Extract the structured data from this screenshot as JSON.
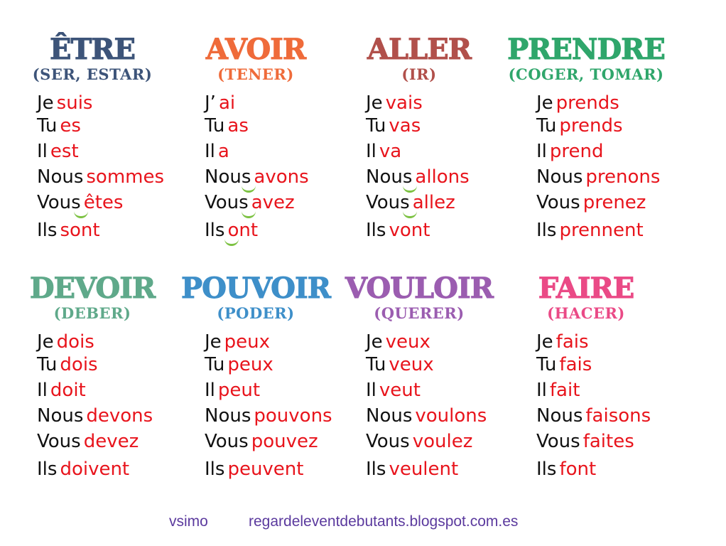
{
  "colors": {
    "pronoun": "#111111",
    "form": "#e8141c",
    "liaison": "#7cc242",
    "footer": "#5b3a9e"
  },
  "verbs": [
    {
      "title": "ÊTRE",
      "translation": "(SER, ESTAR)",
      "color": "#3d5479",
      "rows": [
        [
          "Je",
          "suis"
        ],
        [
          "Tu",
          "es"
        ],
        [
          "Il",
          "est"
        ],
        [
          "Nous",
          "sommes"
        ],
        [
          "Vous",
          "êtes"
        ],
        [
          "Ils",
          "sont"
        ]
      ]
    },
    {
      "title": "AVOIR",
      "translation": "(TENER)",
      "color": "#ef6b3a",
      "rows": [
        [
          "J’",
          "ai"
        ],
        [
          "Tu",
          "as"
        ],
        [
          "Il",
          "a"
        ],
        [
          "Nous",
          "avons"
        ],
        [
          "Vous",
          "avez"
        ],
        [
          "Ils",
          "ont"
        ]
      ]
    },
    {
      "title": "ALLER",
      "translation": "(IR)",
      "color": "#b1504b",
      "rows": [
        [
          "Je",
          "vais"
        ],
        [
          "Tu",
          "vas"
        ],
        [
          "Il",
          "va"
        ],
        [
          "Nous",
          "allons"
        ],
        [
          "Vous",
          "allez"
        ],
        [
          "Ils",
          "vont"
        ]
      ]
    },
    {
      "title": "PRENDRE",
      "translation": "(COGER, TOMAR)",
      "color": "#2fa66b",
      "rows": [
        [
          "Je",
          "prends"
        ],
        [
          "Tu",
          "prends"
        ],
        [
          "Il",
          "prend"
        ],
        [
          "Nous",
          "prenons"
        ],
        [
          "Vous",
          "prenez"
        ],
        [
          "Ils",
          "prennent"
        ]
      ]
    },
    {
      "title": "DEVOIR",
      "translation": "(DEBER)",
      "color": "#5fa98a",
      "rows": [
        [
          "Je",
          "dois"
        ],
        [
          "Tu",
          "dois"
        ],
        [
          "Il",
          "doit"
        ],
        [
          "Nous",
          "devons"
        ],
        [
          "Vous",
          "devez"
        ],
        [
          "Ils",
          "doivent"
        ]
      ]
    },
    {
      "title": "POUVOIR",
      "translation": "(PODER)",
      "color": "#3e8fc9",
      "rows": [
        [
          "Je",
          "peux"
        ],
        [
          "Tu",
          "peux"
        ],
        [
          "Il",
          "peut"
        ],
        [
          "Nous",
          "pouvons"
        ],
        [
          "Vous",
          "pouvez"
        ],
        [
          "Ils",
          "peuvent"
        ]
      ]
    },
    {
      "title": "VOULOIR",
      "translation": "(QUERER)",
      "color": "#9b5db0",
      "rows": [
        [
          "Je",
          "veux"
        ],
        [
          "Tu",
          "veux"
        ],
        [
          "Il",
          "veut"
        ],
        [
          "Nous",
          "voulons"
        ],
        [
          "Vous",
          "voulez"
        ],
        [
          "Ils",
          "veulent"
        ]
      ]
    },
    {
      "title": "FAIRE",
      "translation": "(HACER)",
      "color": "#ea4a86",
      "rows": [
        [
          "Je",
          "fais"
        ],
        [
          "Tu",
          "fais"
        ],
        [
          "Il",
          "fait"
        ],
        [
          "Nous",
          "faisons"
        ],
        [
          "Vous",
          "faites"
        ],
        [
          "Ils",
          "font"
        ]
      ]
    }
  ],
  "footer": {
    "author": "vsimo",
    "url": "regardeleventdebutants.blogspot.com.es"
  }
}
